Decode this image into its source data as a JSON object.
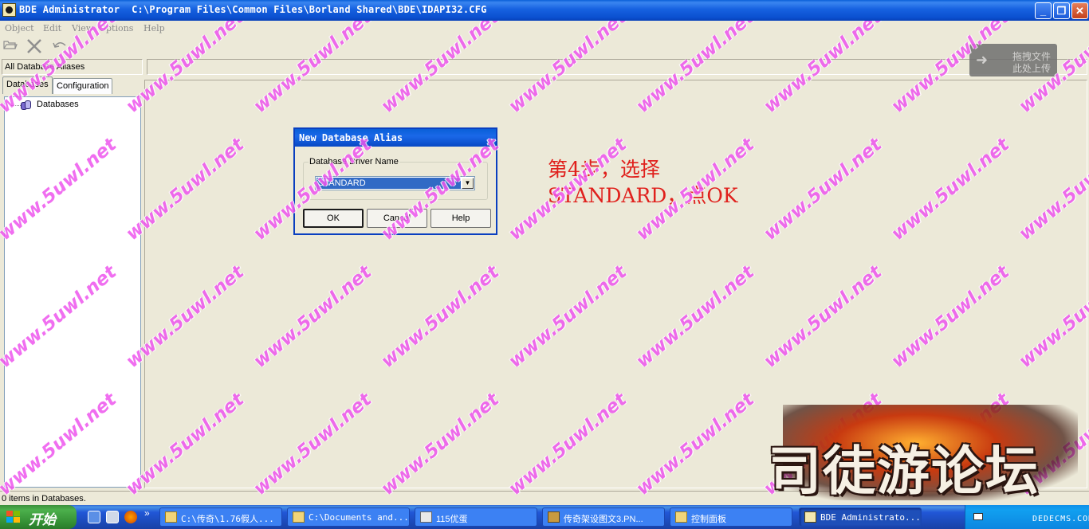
{
  "window": {
    "title": "BDE Administrator  C:\\Program Files\\Common Files\\Borland Shared\\BDE\\IDAPI32.CFG",
    "minimize": "_",
    "restore": "❐",
    "close": "✕"
  },
  "menu": [
    "Object",
    "Edit",
    "View",
    "Options",
    "Help"
  ],
  "toolbar": {
    "open_icon": "folder-open-icon",
    "delete_icon": "delete-x-icon",
    "undo_icon": "undo-icon"
  },
  "left_panel": {
    "header": "All Database Aliases",
    "tabs": [
      "Databases",
      "Configuration"
    ],
    "tree_root": "Databases"
  },
  "status": {
    "text": "0 items in Databases."
  },
  "dialog": {
    "title": "New Database Alias",
    "group_label": "Database Driver Name",
    "driver_value": "STANDARD",
    "buttons": {
      "ok": "OK",
      "cancel": "Cancel",
      "help": "Help"
    }
  },
  "annotation": {
    "line1": "第4步，选择",
    "line2": "STANDARD，点OK",
    "color": "#e0201c"
  },
  "drag_badge": {
    "line1": "拖拽文件",
    "line2": "此处上传"
  },
  "watermark": {
    "text": "www.5uwl.net",
    "color": "#ee55ee"
  },
  "logo": {
    "text": "司徒游论坛"
  },
  "taskbar": {
    "start": "开始",
    "more": "»",
    "tasks": [
      "C:\\传奇\\1.76假人...",
      "C:\\Documents and...",
      "115优蛋",
      "传奇架设图文3.PN...",
      "控制面板",
      "BDE Administrato..."
    ],
    "tray_text": "DEDECMS.COM"
  }
}
